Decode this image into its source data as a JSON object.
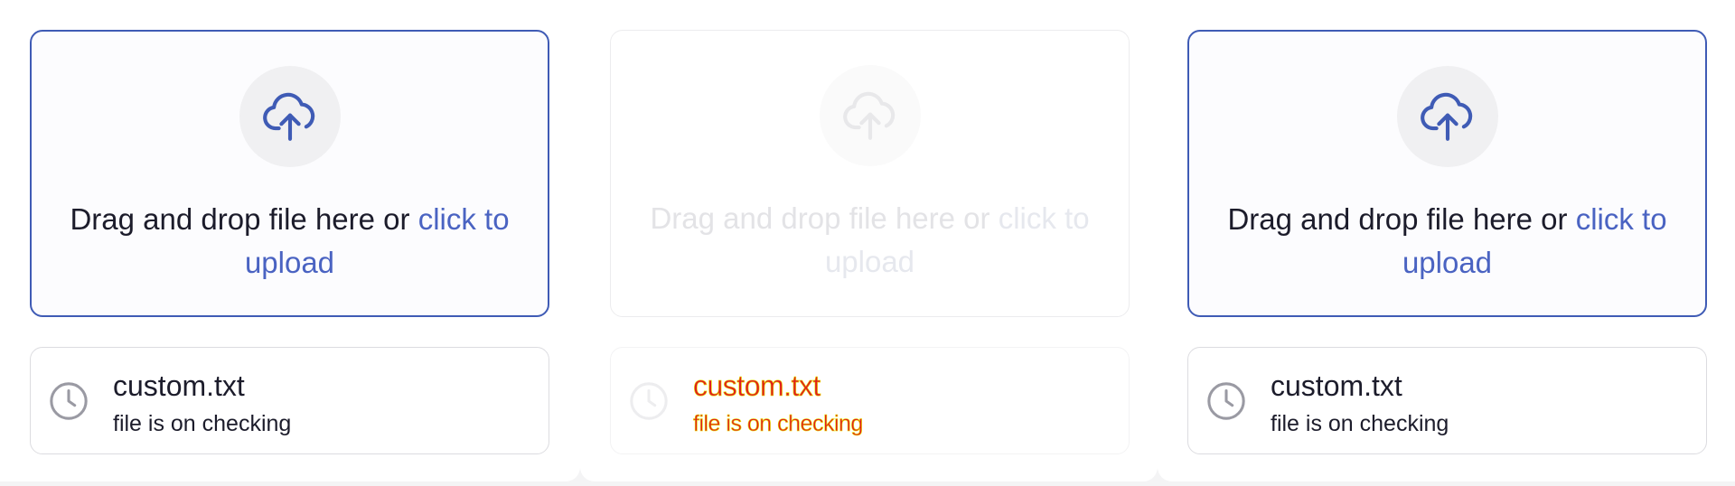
{
  "colors": {
    "accent": "#3f5bb5",
    "link": "#4a63c2",
    "text": "#1c1c2b",
    "icon_gray": "#9a9aa3",
    "disabled_text": "#e3e3e6",
    "glitch_fill": "#e01e1e",
    "glitch_stroke": "#e8e800"
  },
  "uploaders": [
    {
      "state": "active",
      "dropzone": {
        "icon": "cloud-upload-icon",
        "text": "Drag and drop file here or ",
        "link": "click to upload"
      },
      "file": {
        "icon": "clock-icon",
        "name": "custom.txt",
        "status": "file is on checking"
      }
    },
    {
      "state": "disabled",
      "dropzone": {
        "icon": "cloud-upload-icon",
        "text": "Drag and drop file here or ",
        "link": "click to upload"
      },
      "file": {
        "icon": "clock-icon",
        "name": "custom.txt",
        "status": "file is on checking"
      }
    },
    {
      "state": "active",
      "dropzone": {
        "icon": "cloud-upload-icon",
        "text": "Drag and drop file here or ",
        "link": "click to upload"
      },
      "file": {
        "icon": "clock-icon",
        "name": "custom.txt",
        "status": "file is on checking"
      }
    }
  ]
}
